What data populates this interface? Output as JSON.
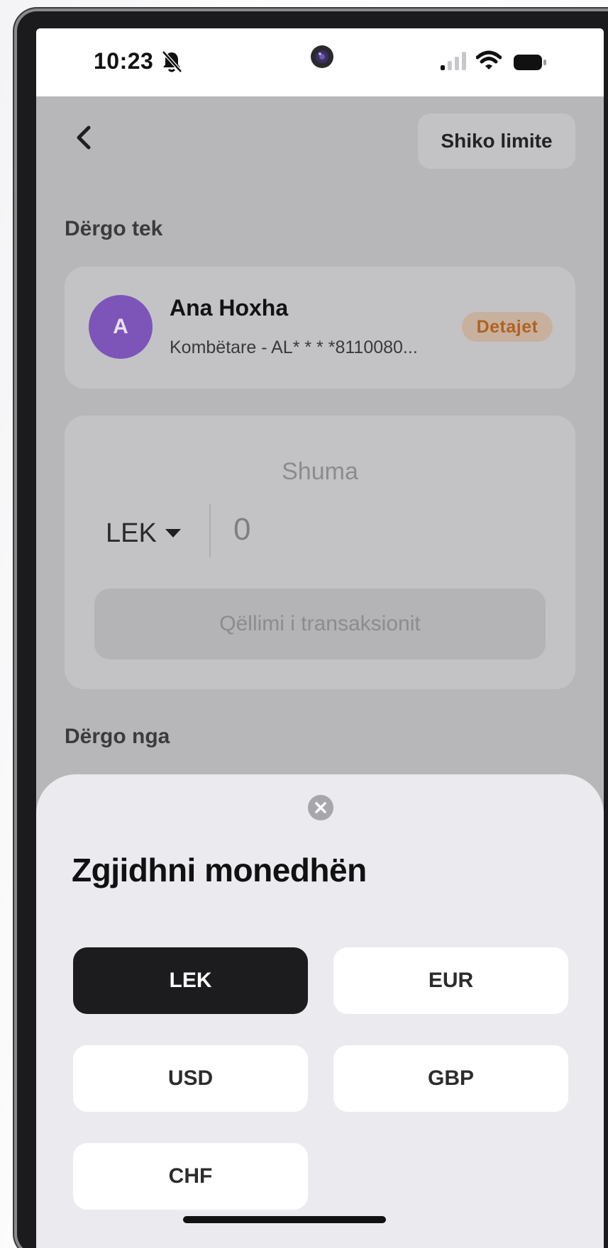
{
  "status_bar": {
    "time": "10:23"
  },
  "header": {
    "limits_button_label": "Shiko limite"
  },
  "send_to": {
    "section_label": "Dërgo tek",
    "recipient": {
      "avatar_initial": "A",
      "name": "Ana Hoxha",
      "account": "Kombëtare - AL* * * *8110080...",
      "details_label": "Detajet"
    }
  },
  "amount": {
    "label": "Shuma",
    "currency": "LEK",
    "value": "0",
    "purpose_placeholder": "Qëllimi i transaksionit"
  },
  "send_from": {
    "section_label": "Dërgo nga"
  },
  "currency_sheet": {
    "title": "Zgjidhni monedhën",
    "options": [
      "LEK",
      "EUR",
      "USD",
      "GBP",
      "CHF"
    ],
    "selected": "LEK"
  },
  "colors": {
    "avatar": "#7d55b8",
    "details_badge_text": "#b0621f",
    "selected_option": "#1c1c1e"
  }
}
